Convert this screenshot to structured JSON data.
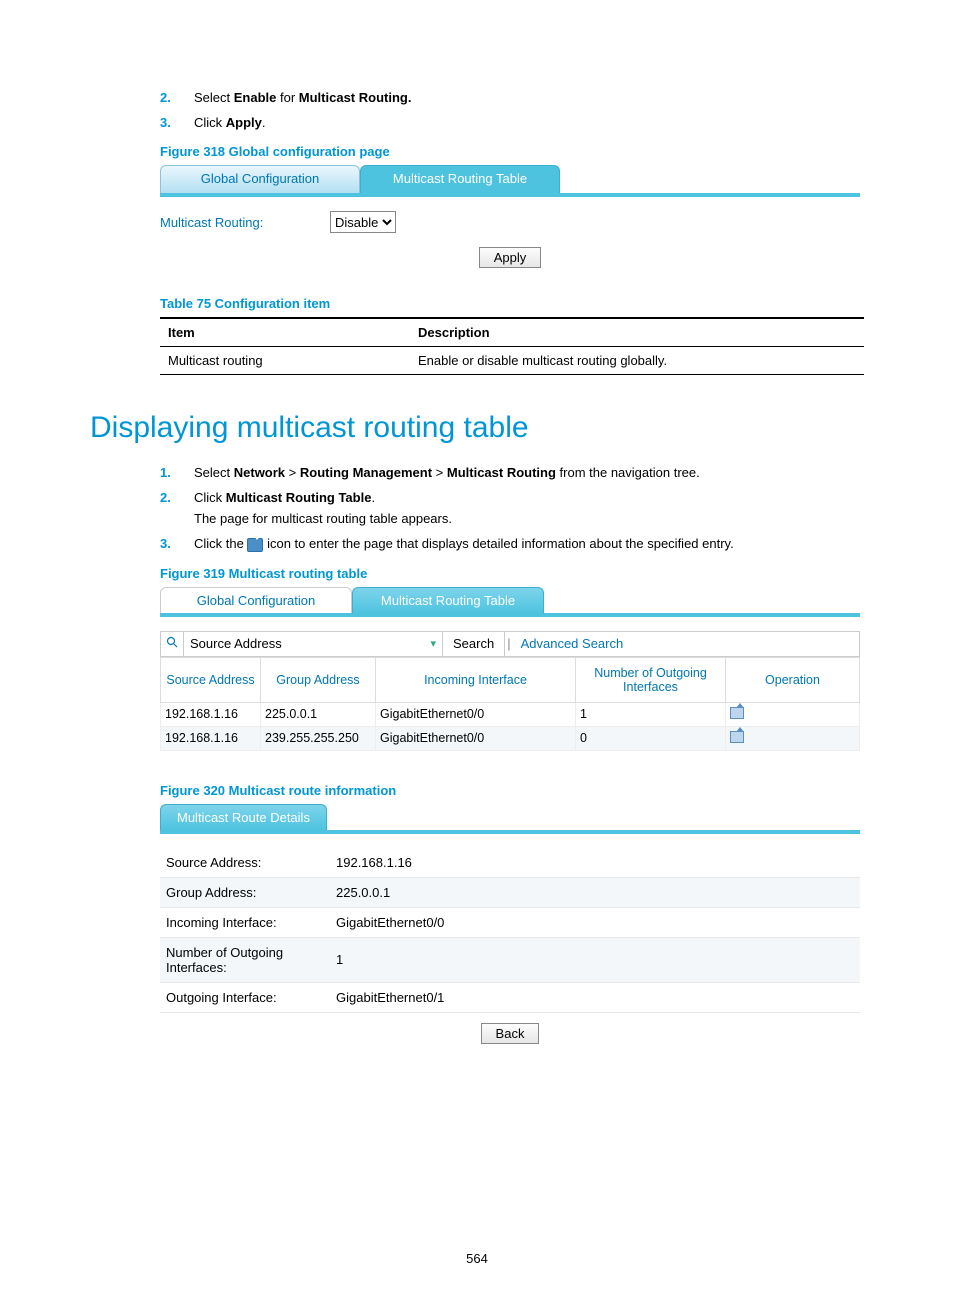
{
  "steps_top": [
    {
      "num": "2.",
      "text_pre": "Select ",
      "b1": "Enable",
      "mid": " for ",
      "b2": "Multicast Routing."
    },
    {
      "num": "3.",
      "text_pre": "Click ",
      "b1": "Apply",
      "mid": ".",
      "b2": ""
    }
  ],
  "fig318": {
    "caption": "Figure 318 Global configuration page",
    "tab_active": "Global Configuration",
    "tab_inactive": "Multicast Routing Table",
    "label": "Multicast Routing:",
    "select_value": "Disable",
    "apply": "Apply"
  },
  "table75": {
    "caption": "Table 75 Configuration item",
    "headers": [
      "Item",
      "Description"
    ],
    "rows": [
      [
        "Multicast routing",
        "Enable or disable multicast routing globally."
      ]
    ]
  },
  "section_heading": "Displaying multicast routing table",
  "steps_section": [
    {
      "num": "1.",
      "parts": [
        "Select ",
        "Network",
        " > ",
        "Routing Management",
        " > ",
        "Multicast Routing",
        " from the navigation tree."
      ],
      "bold_idx": [
        1,
        3,
        5
      ]
    },
    {
      "num": "2.",
      "parts": [
        "Click ",
        "Multicast Routing Table",
        "."
      ],
      "bold_idx": [
        1
      ],
      "sub": "The page for multicast routing table appears."
    },
    {
      "num": "3.",
      "parts_before_icon": "Click the ",
      "parts_after_icon": " icon to enter the page that displays detailed information about the specified entry."
    }
  ],
  "fig319": {
    "caption": "Figure 319 Multicast routing table",
    "tab_inactive": "Global Configuration",
    "tab_active": "Multicast Routing Table",
    "search_field": "Source Address",
    "search_btn": "Search",
    "adv_search": "Advanced Search",
    "headers": [
      "Source Address",
      "Group Address",
      "Incoming Interface",
      "Number of Outgoing Interfaces",
      "Operation"
    ],
    "rows": [
      [
        "192.168.1.16",
        "225.0.0.1",
        "GigabitEthernet0/0",
        "1"
      ],
      [
        "192.168.1.16",
        "239.255.255.250",
        "GigabitEthernet0/0",
        "0"
      ]
    ]
  },
  "fig320": {
    "caption": "Figure 320 Multicast route information",
    "tab": "Multicast Route Details",
    "rows": [
      [
        "Source Address:",
        "192.168.1.16"
      ],
      [
        "Group Address:",
        "225.0.0.1"
      ],
      [
        "Incoming Interface:",
        "GigabitEthernet0/0"
      ],
      [
        "Number of Outgoing Interfaces:",
        "1"
      ],
      [
        "Outgoing Interface:",
        "GigabitEthernet0/1"
      ]
    ],
    "back": "Back"
  },
  "page_number": "564"
}
